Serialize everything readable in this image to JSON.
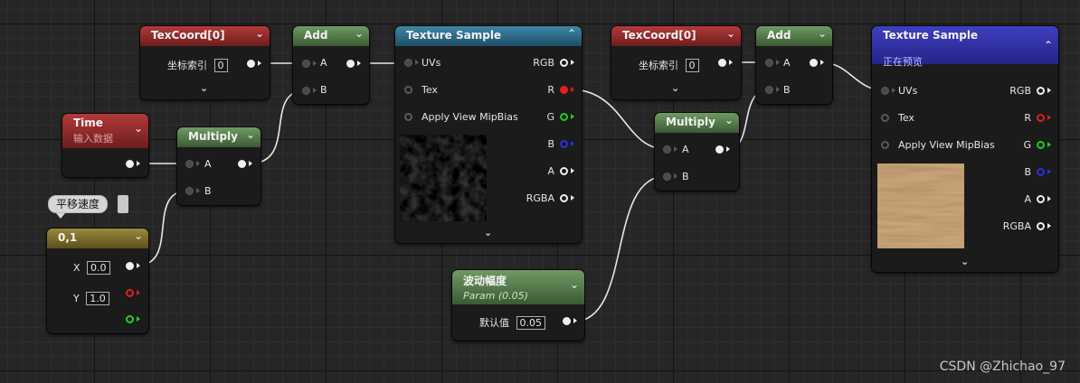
{
  "texcoord1": {
    "title": "TexCoord[0]",
    "label": "坐标索引",
    "value": "0"
  },
  "add1": {
    "title": "Add",
    "a": "A",
    "b": "B"
  },
  "texsample1": {
    "title": "Texture Sample",
    "uvs": "UVs",
    "tex": "Tex",
    "mip": "Apply View MipBias",
    "rgb": "RGB",
    "r": "R",
    "g": "G",
    "b": "B",
    "a": "A",
    "rgba": "RGBA"
  },
  "texcoord2": {
    "title": "TexCoord[0]",
    "label": "坐标索引",
    "value": "0"
  },
  "add2": {
    "title": "Add",
    "a": "A",
    "b": "B"
  },
  "texsample2": {
    "title": "Texture Sample",
    "subtitle": "正在预览",
    "uvs": "UVs",
    "tex": "Tex",
    "mip": "Apply View MipBias",
    "rgb": "RGB",
    "r": "R",
    "g": "G",
    "b": "B",
    "a": "A",
    "rgba": "RGBA"
  },
  "time": {
    "title": "Time",
    "subtitle": "输入数据"
  },
  "multiply1": {
    "title": "Multiply",
    "a": "A",
    "b": "B"
  },
  "multiply2": {
    "title": "Multiply",
    "a": "A",
    "b": "B"
  },
  "comment": {
    "text": "平移速度"
  },
  "const2": {
    "title": "0,1",
    "x_label": "X",
    "x_value": "0.0",
    "y_label": "Y",
    "y_value": "1.0"
  },
  "param": {
    "title": "波动幅度",
    "subtitle": "Param (0.05)",
    "label": "默认值",
    "value": "0.05"
  },
  "watermark": "CSDN @Zhichao_97"
}
